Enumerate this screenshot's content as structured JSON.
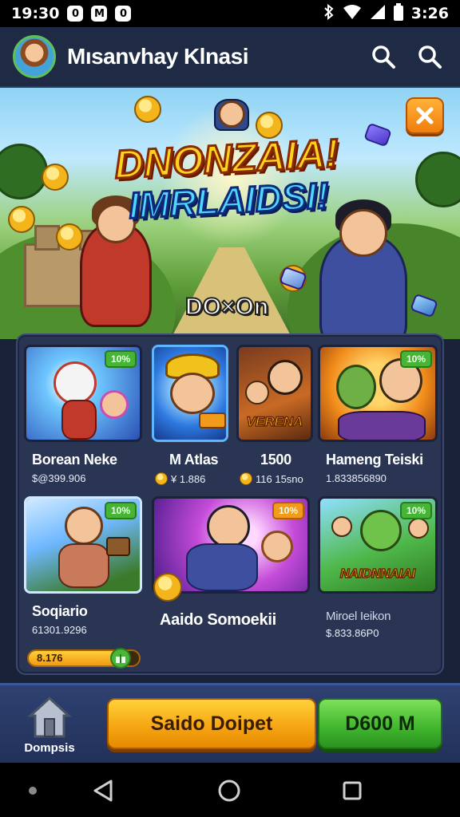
{
  "status_bar": {
    "time": "19:30",
    "badges": [
      "0",
      "M",
      "0"
    ],
    "clock_right": "3:26",
    "icons": [
      "bluetooth-icon",
      "wifi-icon",
      "signal-icon",
      "battery-icon"
    ]
  },
  "header": {
    "title": "Mısanvhay Klnasi",
    "icons": [
      "search-icon",
      "search-icon"
    ]
  },
  "hero": {
    "title_line1": "DNONZAIA!",
    "title_line2": "IMRLAIDSI!",
    "subtitle": "DO×On",
    "close_icon": "close-icon"
  },
  "games": [
    {
      "name": "Borean Neke",
      "price": "$@399.906",
      "tag": "10%",
      "coin": false
    },
    {
      "name": "M Atlas",
      "price": "¥ 1.886",
      "tag": "",
      "coin": true
    },
    {
      "name": "1500",
      "price": "116 15sno",
      "tag": "",
      "coin": true,
      "thumb_text": "VERENA"
    },
    {
      "name": "Hameng Teiski",
      "price": "1.833856890",
      "tag": "10%",
      "coin": false
    },
    {
      "name": "Soqiario",
      "price": "61301.9296",
      "tag": "10%",
      "coin": false
    },
    {
      "name": "Aaido Somoekii",
      "price": "",
      "tag": "10%",
      "coin": true
    },
    {
      "name": "Miroel Ieikon",
      "price": "$.833.86P0",
      "tag": "10%",
      "coin": false,
      "thumb_text": "NAIDNNAIAI"
    }
  ],
  "progress": {
    "label": "8.176",
    "fraction": 0.78
  },
  "action_bar": {
    "deposit_tab_label": "Dompsis",
    "deposit_button": "Saido Doipet",
    "amount_button": "D600 M"
  },
  "colors": {
    "accent_orange": "#f5a311",
    "accent_green": "#3fb52d",
    "header_bg": "#1f2a45",
    "panel_bg": "#2a3554"
  }
}
